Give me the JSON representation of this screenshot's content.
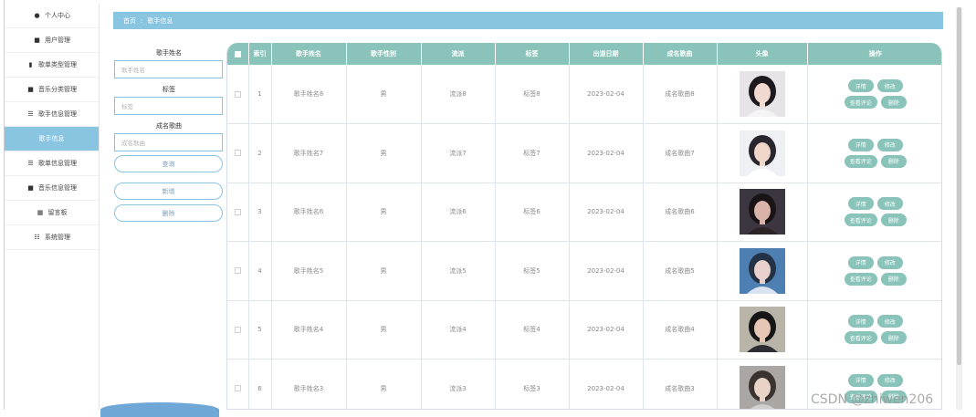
{
  "sidebar": {
    "items": [
      {
        "label": "个人中心",
        "icon": "user-icon",
        "glyph": "●"
      },
      {
        "label": "用户管理",
        "icon": "briefcase-icon",
        "glyph": "■"
      },
      {
        "label": "歌单类型管理",
        "icon": "book-icon",
        "glyph": "▮"
      },
      {
        "label": "音乐分类管理",
        "icon": "monitor-icon",
        "glyph": "■"
      },
      {
        "label": "歌手信息管理",
        "icon": "list-icon",
        "glyph": "☰"
      },
      {
        "label": "歌手信息",
        "icon": "",
        "glyph": "",
        "active": true
      },
      {
        "label": "歌单信息管理",
        "icon": "list-icon",
        "glyph": "☰"
      },
      {
        "label": "音乐信息管理",
        "icon": "monitor-icon",
        "glyph": "■"
      },
      {
        "label": "留言板",
        "icon": "grid-icon",
        "glyph": "▦"
      },
      {
        "label": "系统管理",
        "icon": "sliders-icon",
        "glyph": "☷"
      }
    ]
  },
  "breadcrumb": {
    "home": "首页",
    "sep": ":",
    "current": "歌手信息"
  },
  "search": {
    "name_label": "歌手姓名",
    "name_placeholder": "歌手姓名",
    "tag_label": "标签",
    "tag_placeholder": "标签",
    "song_label": "成名歌曲",
    "song_placeholder": "成名歌曲",
    "query_button": "查询",
    "add_button": "新增",
    "delete_button": "删除"
  },
  "table": {
    "columns": [
      "索引",
      "歌手姓名",
      "歌手性别",
      "流派",
      "标签",
      "出道日期",
      "成名歌曲",
      "头像",
      "操作"
    ],
    "actions": {
      "detail": "详情",
      "edit": "修改",
      "comments": "查看评论",
      "delete": "删除"
    },
    "rows": [
      {
        "index": "1",
        "name": "歌手姓名8",
        "gender": "男",
        "genre": "流派8",
        "tag": "标签8",
        "date": "2023-02-04",
        "song": "成名歌曲8",
        "avatar": "female-portrait-1"
      },
      {
        "index": "2",
        "name": "歌手姓名7",
        "gender": "男",
        "genre": "流派7",
        "tag": "标签7",
        "date": "2023-02-04",
        "song": "成名歌曲7",
        "avatar": "male-portrait-1"
      },
      {
        "index": "3",
        "name": "歌手姓名6",
        "gender": "男",
        "genre": "流派6",
        "tag": "标签6",
        "date": "2023-02-04",
        "song": "成名歌曲6",
        "avatar": "female-portrait-2"
      },
      {
        "index": "4",
        "name": "歌手姓名5",
        "gender": "男",
        "genre": "流派5",
        "tag": "标签5",
        "date": "2023-02-04",
        "song": "成名歌曲5",
        "avatar": "male-portrait-2"
      },
      {
        "index": "5",
        "name": "歌手姓名4",
        "gender": "男",
        "genre": "流派4",
        "tag": "标签4",
        "date": "2023-02-04",
        "song": "成名歌曲4",
        "avatar": "female-portrait-3"
      },
      {
        "index": "6",
        "name": "歌手姓名3",
        "gender": "男",
        "genre": "流派3",
        "tag": "标签3",
        "date": "2023-02-04",
        "song": "成名歌曲3",
        "avatar": "female-portrait-4"
      }
    ]
  },
  "colors": {
    "accent": "#89c4e1",
    "table_header": "#89c3b9",
    "action_button": "#89c3b9"
  },
  "watermark": "CSDN @zhiwen206"
}
